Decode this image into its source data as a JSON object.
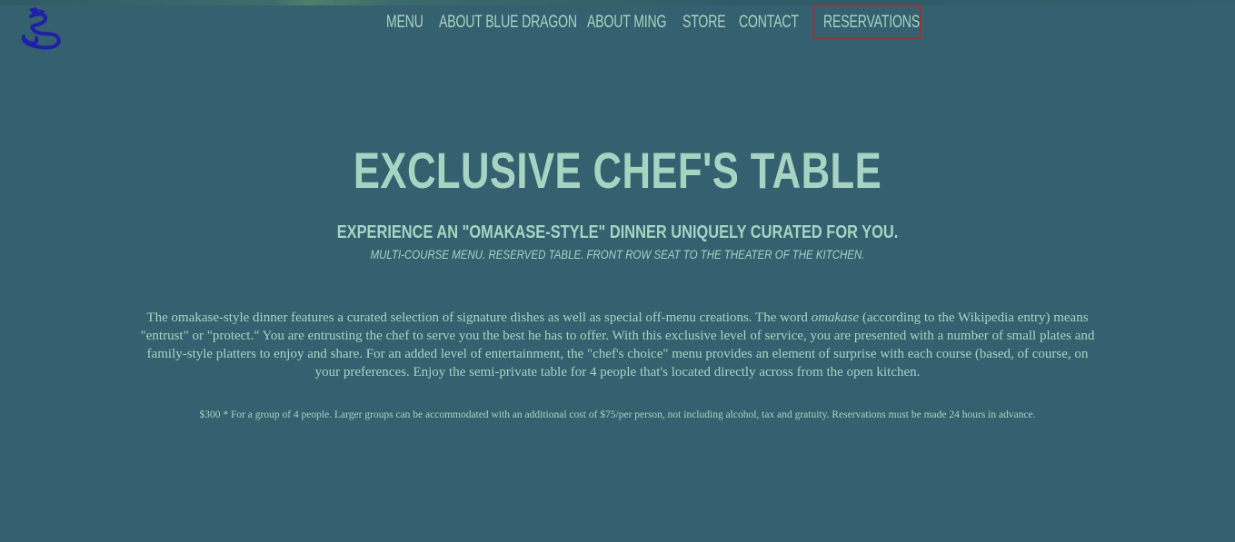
{
  "nav": {
    "logo_icon": "blue-dragon-logo-icon",
    "items": [
      {
        "label": "MENU"
      },
      {
        "label": "ABOUT BLUE DRAGON"
      },
      {
        "label": "ABOUT MING"
      },
      {
        "label": "STORE"
      },
      {
        "label": "CONTACT"
      },
      {
        "label": "RESERVATIONS"
      }
    ],
    "highlighted_item": "RESERVATIONS",
    "highlight_color": "#8a3a3c"
  },
  "hero": {
    "title": "EXCLUSIVE CHEF'S TABLE",
    "subtitle": "EXPERIENCE AN \"OMAKASE-STYLE\" DINNER UNIQUELY CURATED FOR YOU.",
    "tagline": "MULTI-COURSE MENU. RESERVED TABLE. FRONT ROW SEAT TO THE THEATER OF THE KITCHEN."
  },
  "description": {
    "part1": "The omakase-style dinner features a curated selection of signature dishes as well as special off-menu creations. The word ",
    "emphasis": "omakase",
    "part2": " (according to the Wikipedia entry) means \"entrust\" or \"protect.\" You are entrusting the chef to serve you the best he has to offer. With this exclusive level of service, you are presented with a number of small plates and family-style platters to enjoy and share. For an added level of entertainment, the \"chef's choice\" menu provides an element of surprise with each course (based, of course, on your preferences. Enjoy the semi-private table for 4 people that's located directly across from the open kitchen."
  },
  "pricing": {
    "text": "$300 * For a group of 4 people. Larger groups can be accommodated with an additional cost of $75/per person, not including alcohol, tax and gratuity. Reservations must be made 24 hours in advance."
  },
  "colors": {
    "background": "#35606f",
    "text": "#a6d3c2",
    "logo": "#1f1fa8"
  }
}
